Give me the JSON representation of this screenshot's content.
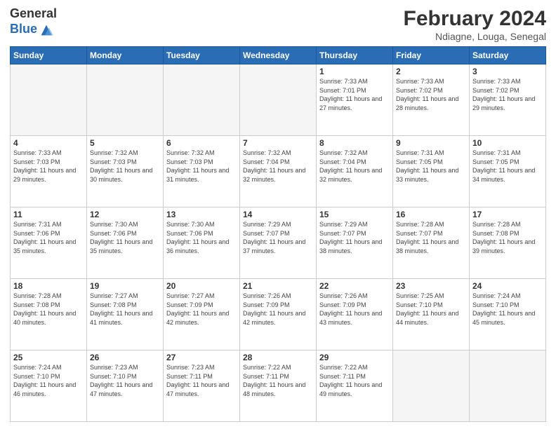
{
  "logo": {
    "general": "General",
    "blue": "Blue"
  },
  "header": {
    "title": "February 2024",
    "subtitle": "Ndiagne, Louga, Senegal"
  },
  "weekdays": [
    "Sunday",
    "Monday",
    "Tuesday",
    "Wednesday",
    "Thursday",
    "Friday",
    "Saturday"
  ],
  "weeks": [
    [
      {
        "num": "",
        "info": ""
      },
      {
        "num": "",
        "info": ""
      },
      {
        "num": "",
        "info": ""
      },
      {
        "num": "",
        "info": ""
      },
      {
        "num": "1",
        "info": "Sunrise: 7:33 AM\nSunset: 7:01 PM\nDaylight: 11 hours and 27 minutes."
      },
      {
        "num": "2",
        "info": "Sunrise: 7:33 AM\nSunset: 7:02 PM\nDaylight: 11 hours and 28 minutes."
      },
      {
        "num": "3",
        "info": "Sunrise: 7:33 AM\nSunset: 7:02 PM\nDaylight: 11 hours and 29 minutes."
      }
    ],
    [
      {
        "num": "4",
        "info": "Sunrise: 7:33 AM\nSunset: 7:03 PM\nDaylight: 11 hours and 29 minutes."
      },
      {
        "num": "5",
        "info": "Sunrise: 7:32 AM\nSunset: 7:03 PM\nDaylight: 11 hours and 30 minutes."
      },
      {
        "num": "6",
        "info": "Sunrise: 7:32 AM\nSunset: 7:03 PM\nDaylight: 11 hours and 31 minutes."
      },
      {
        "num": "7",
        "info": "Sunrise: 7:32 AM\nSunset: 7:04 PM\nDaylight: 11 hours and 32 minutes."
      },
      {
        "num": "8",
        "info": "Sunrise: 7:32 AM\nSunset: 7:04 PM\nDaylight: 11 hours and 32 minutes."
      },
      {
        "num": "9",
        "info": "Sunrise: 7:31 AM\nSunset: 7:05 PM\nDaylight: 11 hours and 33 minutes."
      },
      {
        "num": "10",
        "info": "Sunrise: 7:31 AM\nSunset: 7:05 PM\nDaylight: 11 hours and 34 minutes."
      }
    ],
    [
      {
        "num": "11",
        "info": "Sunrise: 7:31 AM\nSunset: 7:06 PM\nDaylight: 11 hours and 35 minutes."
      },
      {
        "num": "12",
        "info": "Sunrise: 7:30 AM\nSunset: 7:06 PM\nDaylight: 11 hours and 35 minutes."
      },
      {
        "num": "13",
        "info": "Sunrise: 7:30 AM\nSunset: 7:06 PM\nDaylight: 11 hours and 36 minutes."
      },
      {
        "num": "14",
        "info": "Sunrise: 7:29 AM\nSunset: 7:07 PM\nDaylight: 11 hours and 37 minutes."
      },
      {
        "num": "15",
        "info": "Sunrise: 7:29 AM\nSunset: 7:07 PM\nDaylight: 11 hours and 38 minutes."
      },
      {
        "num": "16",
        "info": "Sunrise: 7:28 AM\nSunset: 7:07 PM\nDaylight: 11 hours and 38 minutes."
      },
      {
        "num": "17",
        "info": "Sunrise: 7:28 AM\nSunset: 7:08 PM\nDaylight: 11 hours and 39 minutes."
      }
    ],
    [
      {
        "num": "18",
        "info": "Sunrise: 7:28 AM\nSunset: 7:08 PM\nDaylight: 11 hours and 40 minutes."
      },
      {
        "num": "19",
        "info": "Sunrise: 7:27 AM\nSunset: 7:08 PM\nDaylight: 11 hours and 41 minutes."
      },
      {
        "num": "20",
        "info": "Sunrise: 7:27 AM\nSunset: 7:09 PM\nDaylight: 11 hours and 42 minutes."
      },
      {
        "num": "21",
        "info": "Sunrise: 7:26 AM\nSunset: 7:09 PM\nDaylight: 11 hours and 42 minutes."
      },
      {
        "num": "22",
        "info": "Sunrise: 7:26 AM\nSunset: 7:09 PM\nDaylight: 11 hours and 43 minutes."
      },
      {
        "num": "23",
        "info": "Sunrise: 7:25 AM\nSunset: 7:10 PM\nDaylight: 11 hours and 44 minutes."
      },
      {
        "num": "24",
        "info": "Sunrise: 7:24 AM\nSunset: 7:10 PM\nDaylight: 11 hours and 45 minutes."
      }
    ],
    [
      {
        "num": "25",
        "info": "Sunrise: 7:24 AM\nSunset: 7:10 PM\nDaylight: 11 hours and 46 minutes."
      },
      {
        "num": "26",
        "info": "Sunrise: 7:23 AM\nSunset: 7:10 PM\nDaylight: 11 hours and 47 minutes."
      },
      {
        "num": "27",
        "info": "Sunrise: 7:23 AM\nSunset: 7:11 PM\nDaylight: 11 hours and 47 minutes."
      },
      {
        "num": "28",
        "info": "Sunrise: 7:22 AM\nSunset: 7:11 PM\nDaylight: 11 hours and 48 minutes."
      },
      {
        "num": "29",
        "info": "Sunrise: 7:22 AM\nSunset: 7:11 PM\nDaylight: 11 hours and 49 minutes."
      },
      {
        "num": "",
        "info": ""
      },
      {
        "num": "",
        "info": ""
      }
    ]
  ]
}
